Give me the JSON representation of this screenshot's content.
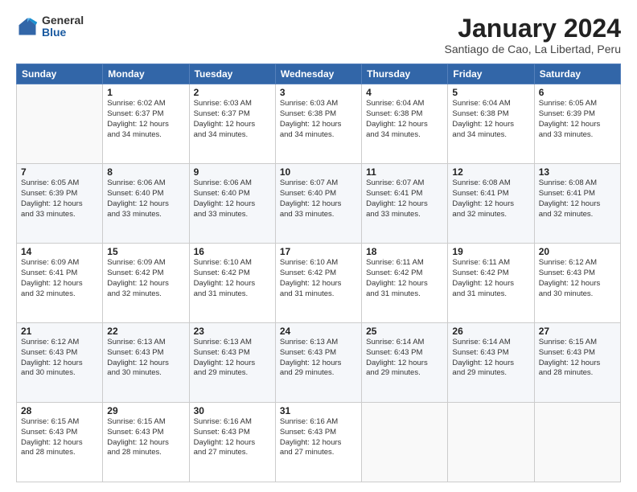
{
  "header": {
    "logo": {
      "general": "General",
      "blue": "Blue"
    },
    "title": "January 2024",
    "location": "Santiago de Cao, La Libertad, Peru"
  },
  "weekdays": [
    "Sunday",
    "Monday",
    "Tuesday",
    "Wednesday",
    "Thursday",
    "Friday",
    "Saturday"
  ],
  "weeks": [
    [
      {
        "day": "",
        "info": ""
      },
      {
        "day": "1",
        "info": "Sunrise: 6:02 AM\nSunset: 6:37 PM\nDaylight: 12 hours\nand 34 minutes."
      },
      {
        "day": "2",
        "info": "Sunrise: 6:03 AM\nSunset: 6:37 PM\nDaylight: 12 hours\nand 34 minutes."
      },
      {
        "day": "3",
        "info": "Sunrise: 6:03 AM\nSunset: 6:38 PM\nDaylight: 12 hours\nand 34 minutes."
      },
      {
        "day": "4",
        "info": "Sunrise: 6:04 AM\nSunset: 6:38 PM\nDaylight: 12 hours\nand 34 minutes."
      },
      {
        "day": "5",
        "info": "Sunrise: 6:04 AM\nSunset: 6:38 PM\nDaylight: 12 hours\nand 34 minutes."
      },
      {
        "day": "6",
        "info": "Sunrise: 6:05 AM\nSunset: 6:39 PM\nDaylight: 12 hours\nand 33 minutes."
      }
    ],
    [
      {
        "day": "7",
        "info": "Sunrise: 6:05 AM\nSunset: 6:39 PM\nDaylight: 12 hours\nand 33 minutes."
      },
      {
        "day": "8",
        "info": "Sunrise: 6:06 AM\nSunset: 6:40 PM\nDaylight: 12 hours\nand 33 minutes."
      },
      {
        "day": "9",
        "info": "Sunrise: 6:06 AM\nSunset: 6:40 PM\nDaylight: 12 hours\nand 33 minutes."
      },
      {
        "day": "10",
        "info": "Sunrise: 6:07 AM\nSunset: 6:40 PM\nDaylight: 12 hours\nand 33 minutes."
      },
      {
        "day": "11",
        "info": "Sunrise: 6:07 AM\nSunset: 6:41 PM\nDaylight: 12 hours\nand 33 minutes."
      },
      {
        "day": "12",
        "info": "Sunrise: 6:08 AM\nSunset: 6:41 PM\nDaylight: 12 hours\nand 32 minutes."
      },
      {
        "day": "13",
        "info": "Sunrise: 6:08 AM\nSunset: 6:41 PM\nDaylight: 12 hours\nand 32 minutes."
      }
    ],
    [
      {
        "day": "14",
        "info": "Sunrise: 6:09 AM\nSunset: 6:41 PM\nDaylight: 12 hours\nand 32 minutes."
      },
      {
        "day": "15",
        "info": "Sunrise: 6:09 AM\nSunset: 6:42 PM\nDaylight: 12 hours\nand 32 minutes."
      },
      {
        "day": "16",
        "info": "Sunrise: 6:10 AM\nSunset: 6:42 PM\nDaylight: 12 hours\nand 31 minutes."
      },
      {
        "day": "17",
        "info": "Sunrise: 6:10 AM\nSunset: 6:42 PM\nDaylight: 12 hours\nand 31 minutes."
      },
      {
        "day": "18",
        "info": "Sunrise: 6:11 AM\nSunset: 6:42 PM\nDaylight: 12 hours\nand 31 minutes."
      },
      {
        "day": "19",
        "info": "Sunrise: 6:11 AM\nSunset: 6:42 PM\nDaylight: 12 hours\nand 31 minutes."
      },
      {
        "day": "20",
        "info": "Sunrise: 6:12 AM\nSunset: 6:43 PM\nDaylight: 12 hours\nand 30 minutes."
      }
    ],
    [
      {
        "day": "21",
        "info": "Sunrise: 6:12 AM\nSunset: 6:43 PM\nDaylight: 12 hours\nand 30 minutes."
      },
      {
        "day": "22",
        "info": "Sunrise: 6:13 AM\nSunset: 6:43 PM\nDaylight: 12 hours\nand 30 minutes."
      },
      {
        "day": "23",
        "info": "Sunrise: 6:13 AM\nSunset: 6:43 PM\nDaylight: 12 hours\nand 29 minutes."
      },
      {
        "day": "24",
        "info": "Sunrise: 6:13 AM\nSunset: 6:43 PM\nDaylight: 12 hours\nand 29 minutes."
      },
      {
        "day": "25",
        "info": "Sunrise: 6:14 AM\nSunset: 6:43 PM\nDaylight: 12 hours\nand 29 minutes."
      },
      {
        "day": "26",
        "info": "Sunrise: 6:14 AM\nSunset: 6:43 PM\nDaylight: 12 hours\nand 29 minutes."
      },
      {
        "day": "27",
        "info": "Sunrise: 6:15 AM\nSunset: 6:43 PM\nDaylight: 12 hours\nand 28 minutes."
      }
    ],
    [
      {
        "day": "28",
        "info": "Sunrise: 6:15 AM\nSunset: 6:43 PM\nDaylight: 12 hours\nand 28 minutes."
      },
      {
        "day": "29",
        "info": "Sunrise: 6:15 AM\nSunset: 6:43 PM\nDaylight: 12 hours\nand 28 minutes."
      },
      {
        "day": "30",
        "info": "Sunrise: 6:16 AM\nSunset: 6:43 PM\nDaylight: 12 hours\nand 27 minutes."
      },
      {
        "day": "31",
        "info": "Sunrise: 6:16 AM\nSunset: 6:43 PM\nDaylight: 12 hours\nand 27 minutes."
      },
      {
        "day": "",
        "info": ""
      },
      {
        "day": "",
        "info": ""
      },
      {
        "day": "",
        "info": ""
      }
    ]
  ]
}
